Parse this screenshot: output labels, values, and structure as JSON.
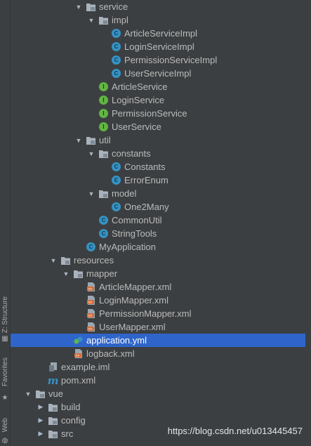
{
  "side_tabs": {
    "structure": "Z: Structure",
    "favorites": "Favorites",
    "web": "Web"
  },
  "tree": [
    {
      "label": "service",
      "icon": "folder",
      "expanded": true,
      "depth": 5
    },
    {
      "label": "impl",
      "icon": "folder",
      "expanded": true,
      "depth": 6
    },
    {
      "label": "ArticleServiceImpl",
      "icon": "class",
      "depth": 7
    },
    {
      "label": "LoginServiceImpl",
      "icon": "class",
      "depth": 7
    },
    {
      "label": "PermissionServiceImpl",
      "icon": "class",
      "depth": 7
    },
    {
      "label": "UserServiceImpl",
      "icon": "class",
      "depth": 7
    },
    {
      "label": "ArticleService",
      "icon": "interface",
      "depth": 6
    },
    {
      "label": "LoginService",
      "icon": "interface",
      "depth": 6
    },
    {
      "label": "PermissionService",
      "icon": "interface",
      "depth": 6
    },
    {
      "label": "UserService",
      "icon": "interface",
      "depth": 6
    },
    {
      "label": "util",
      "icon": "folder",
      "expanded": true,
      "depth": 5
    },
    {
      "label": "constants",
      "icon": "folder",
      "expanded": true,
      "depth": 6
    },
    {
      "label": "Constants",
      "icon": "class",
      "depth": 7
    },
    {
      "label": "ErrorEnum",
      "icon": "enum",
      "depth": 7
    },
    {
      "label": "model",
      "icon": "folder",
      "expanded": true,
      "depth": 6
    },
    {
      "label": "One2Many",
      "icon": "class",
      "depth": 7
    },
    {
      "label": "CommonUtil",
      "icon": "class",
      "depth": 6
    },
    {
      "label": "StringTools",
      "icon": "class",
      "depth": 6
    },
    {
      "label": "MyApplication",
      "icon": "class",
      "depth": 5
    },
    {
      "label": "resources",
      "icon": "folder-res",
      "expanded": true,
      "depth": 3
    },
    {
      "label": "mapper",
      "icon": "folder",
      "expanded": true,
      "depth": 4
    },
    {
      "label": "ArticleMapper.xml",
      "icon": "xml",
      "depth": 5
    },
    {
      "label": "LoginMapper.xml",
      "icon": "xml",
      "depth": 5
    },
    {
      "label": "PermissionMapper.xml",
      "icon": "xml",
      "depth": 5
    },
    {
      "label": "UserMapper.xml",
      "icon": "xml",
      "depth": 5
    },
    {
      "label": "application.yml",
      "icon": "yml",
      "depth": 4,
      "selected": true
    },
    {
      "label": "logback.xml",
      "icon": "xml",
      "depth": 4
    },
    {
      "label": "example.iml",
      "icon": "iml",
      "depth": 2
    },
    {
      "label": "pom.xml",
      "icon": "maven",
      "depth": 2
    },
    {
      "label": "vue",
      "icon": "folder",
      "expanded": true,
      "depth": 1
    },
    {
      "label": "build",
      "icon": "folder",
      "expanded": false,
      "depth": 2
    },
    {
      "label": "config",
      "icon": "folder",
      "expanded": false,
      "depth": 2
    },
    {
      "label": "src",
      "icon": "folder",
      "expanded": false,
      "depth": 2
    }
  ],
  "watermark": "https://blog.csdn.net/u013445457",
  "colors": {
    "background": "#3c3f41",
    "selection": "#2f65ca",
    "class_icon": "#3592c4",
    "interface_icon": "#62b543",
    "xml_icon": "#d2703c"
  }
}
